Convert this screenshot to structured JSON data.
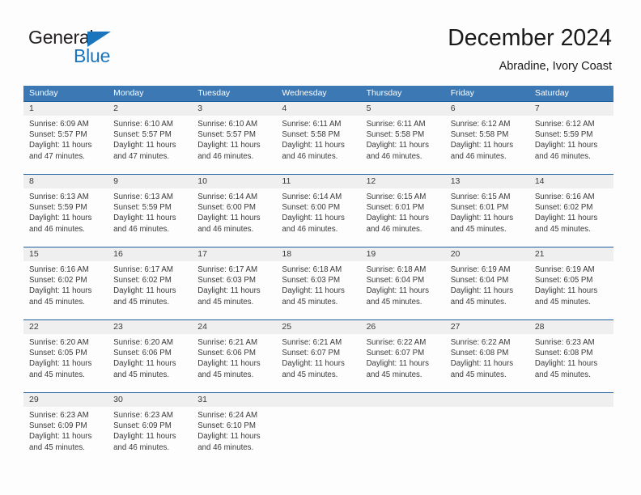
{
  "brand": {
    "name_part1": "General",
    "name_part2": "Blue",
    "accent_color": "#1b75bc"
  },
  "header": {
    "title": "December 2024",
    "subtitle": "Abradine, Ivory Coast"
  },
  "calendar": {
    "header_color": "#3c78b4",
    "weekdays": [
      "Sunday",
      "Monday",
      "Tuesday",
      "Wednesday",
      "Thursday",
      "Friday",
      "Saturday"
    ],
    "weeks": [
      [
        {
          "day": "1",
          "sunrise": "Sunrise: 6:09 AM",
          "sunset": "Sunset: 5:57 PM",
          "daylight_1": "Daylight: 11 hours",
          "daylight_2": "and 47 minutes."
        },
        {
          "day": "2",
          "sunrise": "Sunrise: 6:10 AM",
          "sunset": "Sunset: 5:57 PM",
          "daylight_1": "Daylight: 11 hours",
          "daylight_2": "and 47 minutes."
        },
        {
          "day": "3",
          "sunrise": "Sunrise: 6:10 AM",
          "sunset": "Sunset: 5:57 PM",
          "daylight_1": "Daylight: 11 hours",
          "daylight_2": "and 46 minutes."
        },
        {
          "day": "4",
          "sunrise": "Sunrise: 6:11 AM",
          "sunset": "Sunset: 5:58 PM",
          "daylight_1": "Daylight: 11 hours",
          "daylight_2": "and 46 minutes."
        },
        {
          "day": "5",
          "sunrise": "Sunrise: 6:11 AM",
          "sunset": "Sunset: 5:58 PM",
          "daylight_1": "Daylight: 11 hours",
          "daylight_2": "and 46 minutes."
        },
        {
          "day": "6",
          "sunrise": "Sunrise: 6:12 AM",
          "sunset": "Sunset: 5:58 PM",
          "daylight_1": "Daylight: 11 hours",
          "daylight_2": "and 46 minutes."
        },
        {
          "day": "7",
          "sunrise": "Sunrise: 6:12 AM",
          "sunset": "Sunset: 5:59 PM",
          "daylight_1": "Daylight: 11 hours",
          "daylight_2": "and 46 minutes."
        }
      ],
      [
        {
          "day": "8",
          "sunrise": "Sunrise: 6:13 AM",
          "sunset": "Sunset: 5:59 PM",
          "daylight_1": "Daylight: 11 hours",
          "daylight_2": "and 46 minutes."
        },
        {
          "day": "9",
          "sunrise": "Sunrise: 6:13 AM",
          "sunset": "Sunset: 5:59 PM",
          "daylight_1": "Daylight: 11 hours",
          "daylight_2": "and 46 minutes."
        },
        {
          "day": "10",
          "sunrise": "Sunrise: 6:14 AM",
          "sunset": "Sunset: 6:00 PM",
          "daylight_1": "Daylight: 11 hours",
          "daylight_2": "and 46 minutes."
        },
        {
          "day": "11",
          "sunrise": "Sunrise: 6:14 AM",
          "sunset": "Sunset: 6:00 PM",
          "daylight_1": "Daylight: 11 hours",
          "daylight_2": "and 46 minutes."
        },
        {
          "day": "12",
          "sunrise": "Sunrise: 6:15 AM",
          "sunset": "Sunset: 6:01 PM",
          "daylight_1": "Daylight: 11 hours",
          "daylight_2": "and 46 minutes."
        },
        {
          "day": "13",
          "sunrise": "Sunrise: 6:15 AM",
          "sunset": "Sunset: 6:01 PM",
          "daylight_1": "Daylight: 11 hours",
          "daylight_2": "and 45 minutes."
        },
        {
          "day": "14",
          "sunrise": "Sunrise: 6:16 AM",
          "sunset": "Sunset: 6:02 PM",
          "daylight_1": "Daylight: 11 hours",
          "daylight_2": "and 45 minutes."
        }
      ],
      [
        {
          "day": "15",
          "sunrise": "Sunrise: 6:16 AM",
          "sunset": "Sunset: 6:02 PM",
          "daylight_1": "Daylight: 11 hours",
          "daylight_2": "and 45 minutes."
        },
        {
          "day": "16",
          "sunrise": "Sunrise: 6:17 AM",
          "sunset": "Sunset: 6:02 PM",
          "daylight_1": "Daylight: 11 hours",
          "daylight_2": "and 45 minutes."
        },
        {
          "day": "17",
          "sunrise": "Sunrise: 6:17 AM",
          "sunset": "Sunset: 6:03 PM",
          "daylight_1": "Daylight: 11 hours",
          "daylight_2": "and 45 minutes."
        },
        {
          "day": "18",
          "sunrise": "Sunrise: 6:18 AM",
          "sunset": "Sunset: 6:03 PM",
          "daylight_1": "Daylight: 11 hours",
          "daylight_2": "and 45 minutes."
        },
        {
          "day": "19",
          "sunrise": "Sunrise: 6:18 AM",
          "sunset": "Sunset: 6:04 PM",
          "daylight_1": "Daylight: 11 hours",
          "daylight_2": "and 45 minutes."
        },
        {
          "day": "20",
          "sunrise": "Sunrise: 6:19 AM",
          "sunset": "Sunset: 6:04 PM",
          "daylight_1": "Daylight: 11 hours",
          "daylight_2": "and 45 minutes."
        },
        {
          "day": "21",
          "sunrise": "Sunrise: 6:19 AM",
          "sunset": "Sunset: 6:05 PM",
          "daylight_1": "Daylight: 11 hours",
          "daylight_2": "and 45 minutes."
        }
      ],
      [
        {
          "day": "22",
          "sunrise": "Sunrise: 6:20 AM",
          "sunset": "Sunset: 6:05 PM",
          "daylight_1": "Daylight: 11 hours",
          "daylight_2": "and 45 minutes."
        },
        {
          "day": "23",
          "sunrise": "Sunrise: 6:20 AM",
          "sunset": "Sunset: 6:06 PM",
          "daylight_1": "Daylight: 11 hours",
          "daylight_2": "and 45 minutes."
        },
        {
          "day": "24",
          "sunrise": "Sunrise: 6:21 AM",
          "sunset": "Sunset: 6:06 PM",
          "daylight_1": "Daylight: 11 hours",
          "daylight_2": "and 45 minutes."
        },
        {
          "day": "25",
          "sunrise": "Sunrise: 6:21 AM",
          "sunset": "Sunset: 6:07 PM",
          "daylight_1": "Daylight: 11 hours",
          "daylight_2": "and 45 minutes."
        },
        {
          "day": "26",
          "sunrise": "Sunrise: 6:22 AM",
          "sunset": "Sunset: 6:07 PM",
          "daylight_1": "Daylight: 11 hours",
          "daylight_2": "and 45 minutes."
        },
        {
          "day": "27",
          "sunrise": "Sunrise: 6:22 AM",
          "sunset": "Sunset: 6:08 PM",
          "daylight_1": "Daylight: 11 hours",
          "daylight_2": "and 45 minutes."
        },
        {
          "day": "28",
          "sunrise": "Sunrise: 6:23 AM",
          "sunset": "Sunset: 6:08 PM",
          "daylight_1": "Daylight: 11 hours",
          "daylight_2": "and 45 minutes."
        }
      ],
      [
        {
          "day": "29",
          "sunrise": "Sunrise: 6:23 AM",
          "sunset": "Sunset: 6:09 PM",
          "daylight_1": "Daylight: 11 hours",
          "daylight_2": "and 45 minutes."
        },
        {
          "day": "30",
          "sunrise": "Sunrise: 6:23 AM",
          "sunset": "Sunset: 6:09 PM",
          "daylight_1": "Daylight: 11 hours",
          "daylight_2": "and 46 minutes."
        },
        {
          "day": "31",
          "sunrise": "Sunrise: 6:24 AM",
          "sunset": "Sunset: 6:10 PM",
          "daylight_1": "Daylight: 11 hours",
          "daylight_2": "and 46 minutes."
        },
        {
          "day": "",
          "sunrise": "",
          "sunset": "",
          "daylight_1": "",
          "daylight_2": ""
        },
        {
          "day": "",
          "sunrise": "",
          "sunset": "",
          "daylight_1": "",
          "daylight_2": ""
        },
        {
          "day": "",
          "sunrise": "",
          "sunset": "",
          "daylight_1": "",
          "daylight_2": ""
        },
        {
          "day": "",
          "sunrise": "",
          "sunset": "",
          "daylight_1": "",
          "daylight_2": ""
        }
      ]
    ]
  }
}
